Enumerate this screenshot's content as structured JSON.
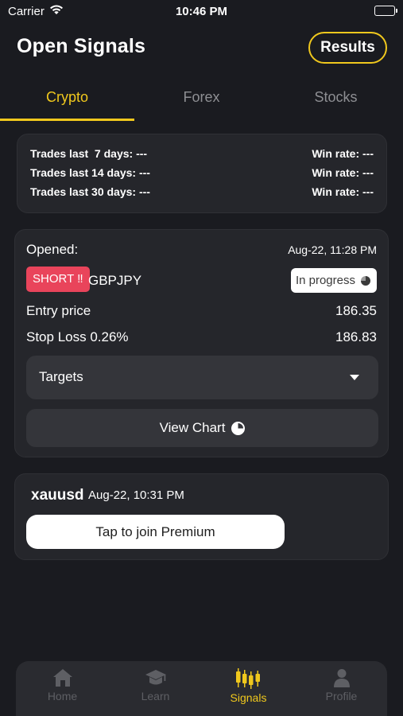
{
  "status_bar": {
    "carrier": "Carrier",
    "time": "10:46 PM",
    "icons": [
      "wifi-icon",
      "battery-icon"
    ]
  },
  "header": {
    "title": "Open Signals",
    "results_label": "Results"
  },
  "tabs": [
    {
      "label": "Crypto",
      "active": true
    },
    {
      "label": "Forex",
      "active": false
    },
    {
      "label": "Stocks",
      "active": false
    }
  ],
  "stats": {
    "rows": [
      {
        "label": "Trades last  7 days: ---",
        "win": "Win rate: ---"
      },
      {
        "label": "Trades last 14 days: ---",
        "win": "Win rate: ---"
      },
      {
        "label": "Trades last 30 days: ---",
        "win": "Win rate: ---"
      }
    ]
  },
  "signal": {
    "opened_label": "Opened:",
    "opened_date": "Aug-22, 11:28 PM",
    "direction": "SHORT ‼",
    "pair": "GBPJPY",
    "status": "In progress",
    "entry_label": "Entry price",
    "entry_value": "186.35",
    "stop_label": "Stop Loss 0.26%",
    "stop_value": "186.83",
    "targets_label": "Targets",
    "view_chart_label": "View Chart"
  },
  "premium_signal": {
    "symbol": "xauusd",
    "date": "Aug-22, 10:31 PM",
    "join_label": "Tap to join Premium"
  },
  "nav": [
    {
      "label": "Home",
      "icon": "home-icon",
      "active": false
    },
    {
      "label": "Learn",
      "icon": "graduation-cap-icon",
      "active": false
    },
    {
      "label": "Signals",
      "icon": "candlestick-icon",
      "active": true
    },
    {
      "label": "Profile",
      "icon": "person-icon",
      "active": false
    }
  ],
  "colors": {
    "background": "#1a1b20",
    "card": "#25262b",
    "accent": "#f0c81d",
    "short_badge": "#e9445b",
    "inactive": "#5e5f64"
  }
}
